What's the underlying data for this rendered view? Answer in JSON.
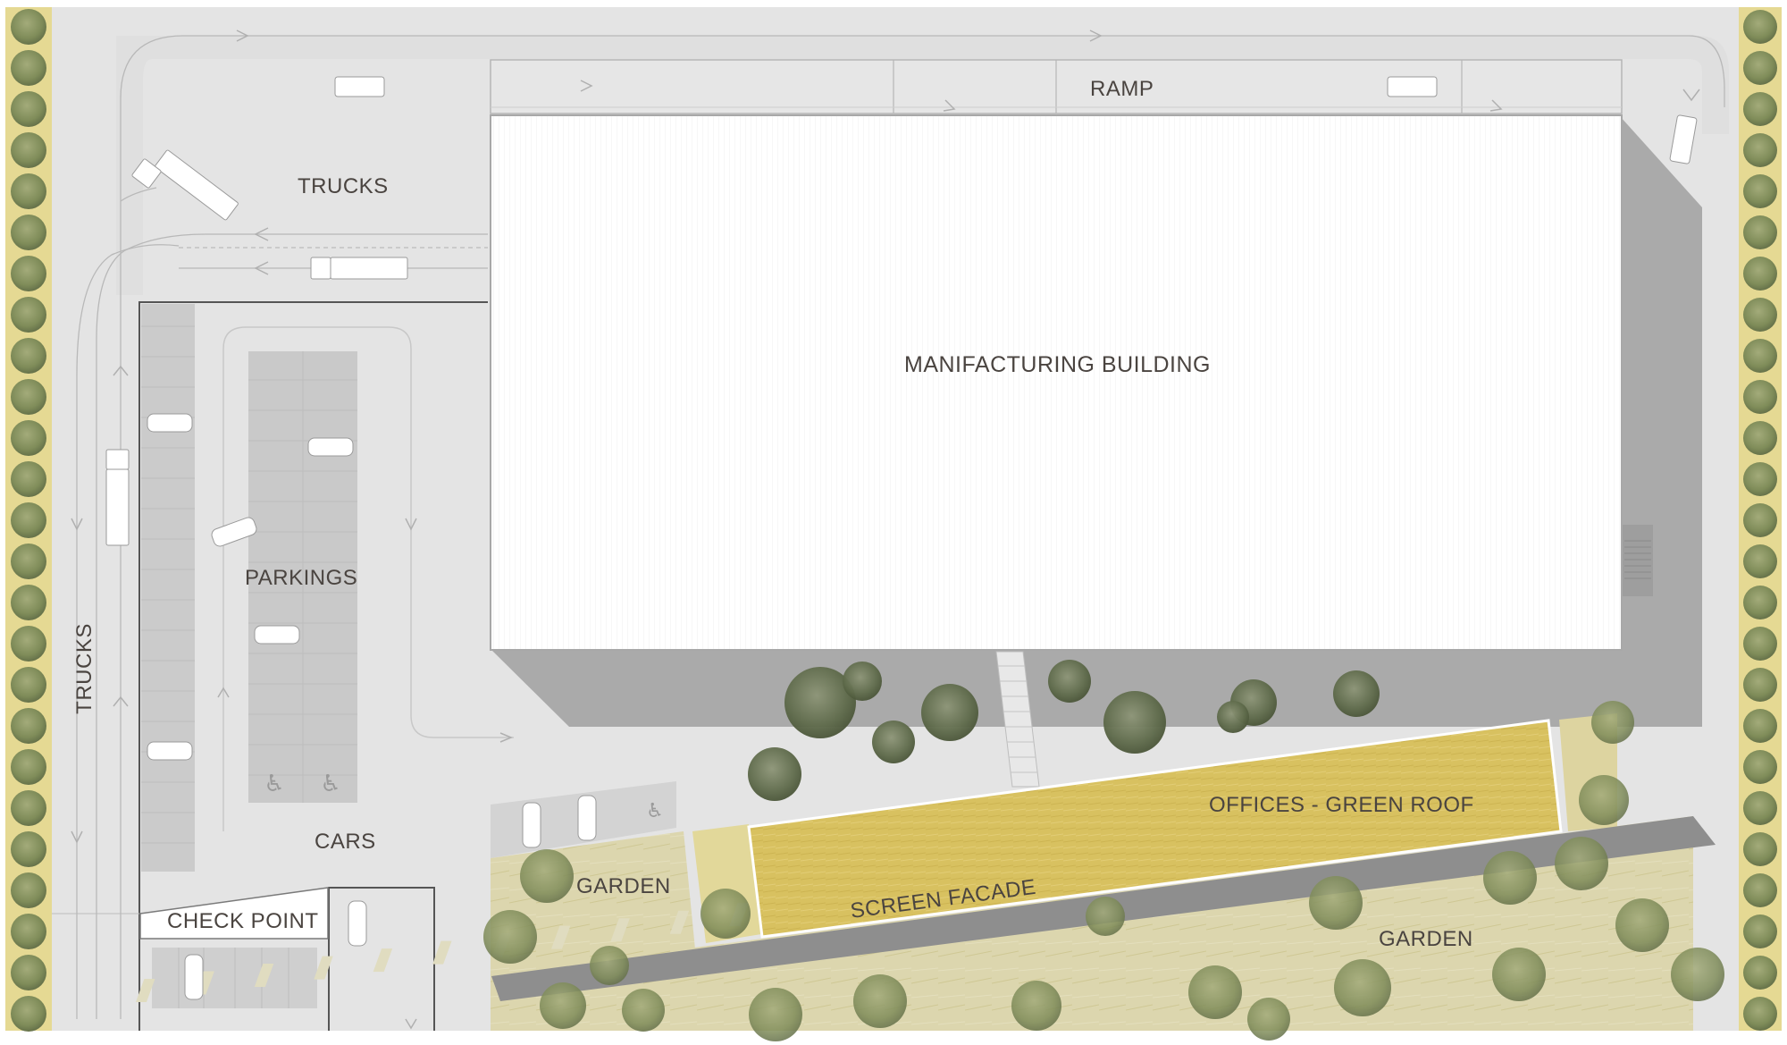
{
  "labels": {
    "ramp": "RAMP",
    "trucks_top": "TRUCKS",
    "trucks_side": "TRUCKS",
    "building": "MANIFACTURING BUILDING",
    "parkings": "PARKINGS",
    "cars": "CARS",
    "check_point": "CHECK POINT",
    "garden_small": "GARDEN",
    "garden_large": "GARDEN",
    "offices": "OFFICES - GREEN ROOF",
    "screen_facade": "SCREEN FACADE"
  },
  "colors": {
    "ground": "#e6e6e6",
    "road": "#dedede",
    "building_roof": "#ffffff",
    "building_shadow": "#a9a9a9",
    "parking": "#c9c9c9",
    "green_roof": "#d8c15e",
    "garden": "#d9d3a8",
    "tree_edge": "#e2d68c",
    "tree": "#8b9a63",
    "facade": "#8f8f8f"
  }
}
